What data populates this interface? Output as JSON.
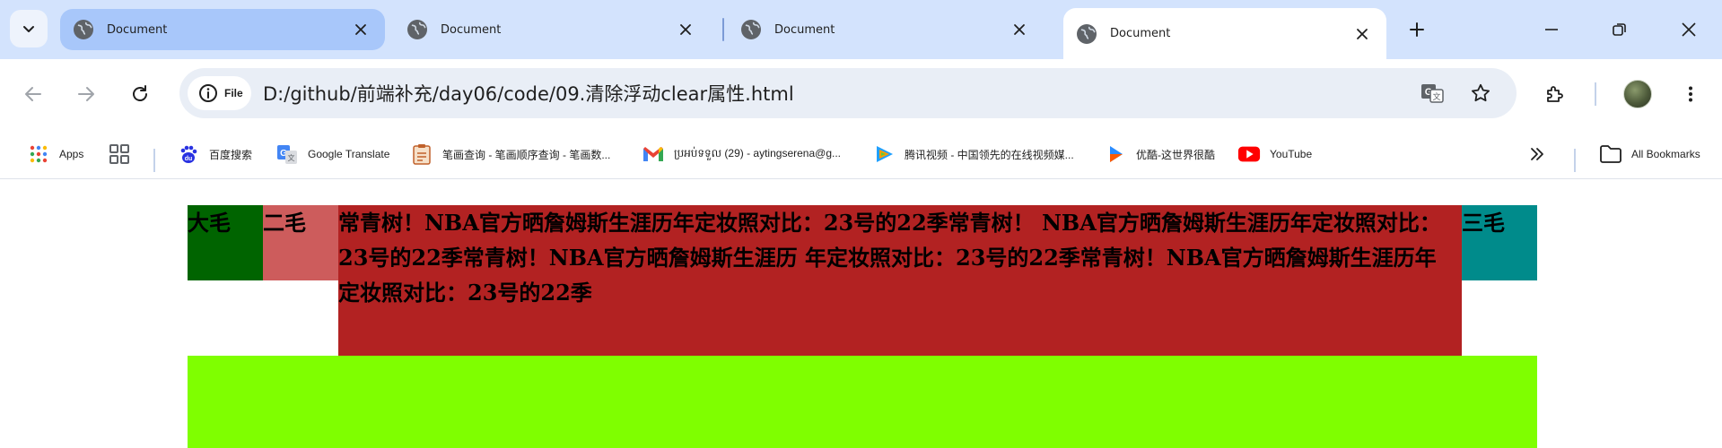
{
  "browser": {
    "tabs": [
      {
        "title": "Document",
        "state": "hover"
      },
      {
        "title": "Document",
        "state": "normal"
      },
      {
        "title": "Document",
        "state": "normal"
      },
      {
        "title": "Document",
        "state": "active"
      }
    ],
    "address": {
      "chip_label": "File",
      "url": "D:/github/前端补充/day06/code/09.清除浮动clear属性.html"
    },
    "bookmarks": [
      {
        "label": "Apps",
        "icon": "apps-grid-icon"
      },
      {
        "label": "",
        "icon": "tab-groups-icon"
      },
      {
        "label": "百度搜索",
        "icon": "baidu-paw-icon"
      },
      {
        "label": "Google Translate",
        "icon": "google-translate-icon"
      },
      {
        "label": "笔画查询 - 笔画顺序查询 - 笔画数...",
        "icon": "notepad-icon"
      },
      {
        "label": "ប្រអប់ទទួល (29) - aytingserena@g...",
        "icon": "gmail-icon"
      },
      {
        "label": "腾讯视频 - 中国领先的在线视频媒...",
        "icon": "tencent-video-icon"
      },
      {
        "label": "优酷-这世界很酷",
        "icon": "youku-icon"
      },
      {
        "label": "YouTube",
        "icon": "youtube-icon"
      }
    ],
    "all_bookmarks_label": "All Bookmarks"
  },
  "page": {
    "box1": "大毛",
    "box2": "二毛",
    "box3": "常青树！NBA官方晒詹姆斯生涯历年定妆照对比：23号的22季常青树！ NBA官方晒詹姆斯生涯历年定妆照对比：23号的22季常青树！NBA官方晒詹姆斯生涯历 年定妆照对比：23号的22季常青树！NBA官方晒詹姆斯生涯历年定妆照对比：23号的22季",
    "box4": "三毛"
  },
  "colors": {
    "box1": "#006400",
    "box2": "#cd5c5c",
    "box3": "#b22222",
    "box4": "#008b8b",
    "footer": "#7fff00",
    "tabstrip": "#d3e3fd"
  }
}
